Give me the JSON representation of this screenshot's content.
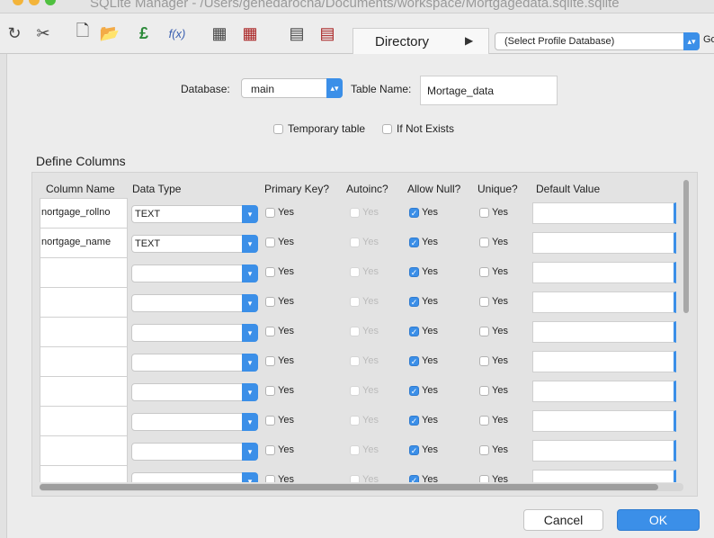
{
  "window": {
    "title": "SQLite Manager - /Users/genedarocha/Documents/workspace/Mortgagedata.sqlite.sqlite",
    "traffic_colors": [
      "#f3b43a",
      "#f3b43a",
      "#4fc03f"
    ]
  },
  "toolbar": {
    "icons": [
      "refresh-icon",
      "tools-icon",
      "new-file-icon",
      "open-folder-icon",
      "connect-icon",
      "function-icon",
      "create-table-icon",
      "drop-table-icon",
      "create-index-icon",
      "drop-index-icon"
    ],
    "function_label": "f(x)",
    "directory_label": "Directory",
    "directory_arrow": "▶",
    "profile_select": "(Select Profile Database)",
    "go_label": "Go"
  },
  "form": {
    "database_label": "Database:",
    "database_value": "main",
    "table_name_label": "Table Name:",
    "table_name_value": "Mortage_data",
    "temporary_label": "Temporary table",
    "if_not_exists_label": "If Not Exists"
  },
  "columns_section": {
    "title": "Define Columns",
    "headers": [
      "Column Name",
      "Data Type",
      "Primary Key?",
      "Autoinc?",
      "Allow Null?",
      "Unique?",
      "Default Value"
    ],
    "yes_label": "Yes",
    "rows": [
      {
        "name": "nortgage_rollno",
        "type": "TEXT",
        "pk": false,
        "autoinc": false,
        "allow_null": true,
        "unique": false,
        "default": ""
      },
      {
        "name": "nortgage_name",
        "type": "TEXT",
        "pk": false,
        "autoinc": false,
        "allow_null": true,
        "unique": false,
        "default": ""
      },
      {
        "name": "",
        "type": "",
        "pk": false,
        "autoinc": false,
        "allow_null": true,
        "unique": false,
        "default": ""
      },
      {
        "name": "",
        "type": "",
        "pk": false,
        "autoinc": false,
        "allow_null": true,
        "unique": false,
        "default": ""
      },
      {
        "name": "",
        "type": "",
        "pk": false,
        "autoinc": false,
        "allow_null": true,
        "unique": false,
        "default": ""
      },
      {
        "name": "",
        "type": "",
        "pk": false,
        "autoinc": false,
        "allow_null": true,
        "unique": false,
        "default": ""
      },
      {
        "name": "",
        "type": "",
        "pk": false,
        "autoinc": false,
        "allow_null": true,
        "unique": false,
        "default": ""
      },
      {
        "name": "",
        "type": "",
        "pk": false,
        "autoinc": false,
        "allow_null": true,
        "unique": false,
        "default": ""
      },
      {
        "name": "",
        "type": "",
        "pk": false,
        "autoinc": false,
        "allow_null": true,
        "unique": false,
        "default": ""
      },
      {
        "name": "",
        "type": "",
        "pk": false,
        "autoinc": false,
        "allow_null": true,
        "unique": false,
        "default": ""
      }
    ]
  },
  "buttons": {
    "cancel": "Cancel",
    "ok": "OK"
  },
  "colors": {
    "accent": "#3b8fe8"
  }
}
